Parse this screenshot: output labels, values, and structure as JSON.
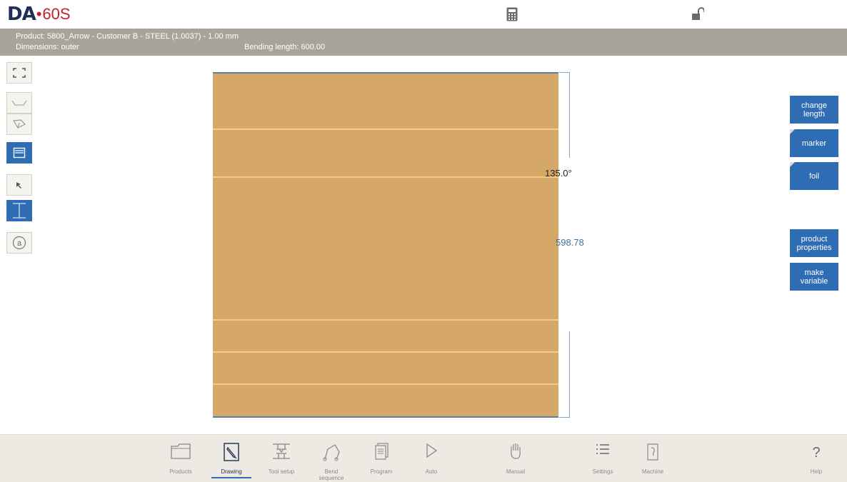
{
  "header": {
    "logo_text": "DA",
    "logo_dot": "•",
    "logo_model": "60S",
    "icons": [
      "calculator-icon",
      "unlock-icon"
    ]
  },
  "info": {
    "product_line": "Product: 5800_Arrow - Customer B - STEEL (1.0037) - 1.00 mm",
    "dimensions_line": "Dimensions: outer",
    "bending_length": "Bending length: 600.00"
  },
  "left_toolbar": {
    "items": [
      {
        "name": "fit-view-icon",
        "active": false
      },
      {
        "name": "profile-2d-icon",
        "active": false
      },
      {
        "name": "profile-3d-icon",
        "active": false
      },
      {
        "name": "flat-view-icon",
        "active": true
      },
      {
        "name": "select-arrow-icon",
        "active": false
      },
      {
        "name": "text-cursor-icon",
        "active": true
      },
      {
        "name": "at-sign-icon",
        "active": false
      }
    ]
  },
  "drawing": {
    "angle_label": "135.0°",
    "dimension_label": "598.78",
    "colors": {
      "sheet": "#d5a86a",
      "bend_line": "#f3cf7b",
      "dimension": "#3e6fa8"
    }
  },
  "right_buttons": [
    {
      "label": "change\nlength",
      "corner": false
    },
    {
      "label": "marker",
      "corner": true
    },
    {
      "label": "foil",
      "corner": true
    },
    {
      "label": "product\nproperties",
      "corner": false
    },
    {
      "label": "make\nvariable",
      "corner": false
    }
  ],
  "bottom_nav": [
    {
      "label": "Products",
      "icon": "folder-icon",
      "active": false
    },
    {
      "label": "Drawing",
      "icon": "drawing-pencil-icon",
      "active": true
    },
    {
      "label": "Tool setup",
      "icon": "tool-setup-icon",
      "active": false
    },
    {
      "label": "Bend\nsequence",
      "icon": "bend-sequence-icon",
      "active": false
    },
    {
      "label": "Program",
      "icon": "program-pages-icon",
      "active": false
    },
    {
      "label": "Auto",
      "icon": "play-icon",
      "active": false
    },
    {
      "label": "Manual",
      "icon": "hand-icon",
      "active": false
    },
    {
      "label": "Settings",
      "icon": "list-icon",
      "active": false
    },
    {
      "label": "Machine",
      "icon": "machine-icon",
      "active": false
    },
    {
      "label": "Help",
      "icon": "help-icon",
      "active": false
    }
  ],
  "accent_color": "#2e6db3"
}
